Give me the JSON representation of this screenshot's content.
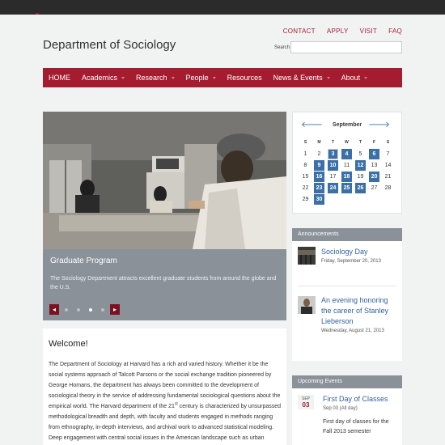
{
  "utility_nav": [
    "CONTACT",
    "APPLY",
    "VISIT",
    "FAQ"
  ],
  "site_title": "Department of Sociology",
  "search": {
    "label": "Search",
    "value": "",
    "placeholder": ""
  },
  "main_nav": [
    {
      "label": "HOME",
      "dropdown": false
    },
    {
      "label": "Academics",
      "dropdown": true
    },
    {
      "label": "Research",
      "dropdown": true
    },
    {
      "label": "People",
      "dropdown": true
    },
    {
      "label": "Resources",
      "dropdown": false
    },
    {
      "label": "News & Events",
      "dropdown": true
    },
    {
      "label": "About",
      "dropdown": true
    }
  ],
  "slider": {
    "title": "Graduate Program",
    "description": "The Sociology Department attracts excellent graduate students from around the globe and the U.S.",
    "prev": "◂",
    "next": "▸",
    "slide_count": 4,
    "active_slide": 3
  },
  "welcome": {
    "heading": "Welcome!",
    "body_part1": "The Department of Sociology at Harvard has a rich and varied history. Whether it be the social systems approach of Talcott Parsons or the social exchange tradition pioneered by George Homans, the department has always been committed to the development of sociological theory in the service of addressing fundamental sociological questions about the empirical world. The Harvard department of the 21",
    "body_sup": "st",
    "body_part2": " century is characterized by unsurpassed methodological breadth and depth, with faculty and students engaged in methods ranging from ethnography, in-depth interviews, and archival work to advanced statistical modeling. Deep engagement with central social issues in the American landscape such as urban inequality and mass incarceration is"
  },
  "calendar": {
    "month": "September",
    "prev": "🡐",
    "next": "🡒",
    "weekdays": [
      "S",
      "M",
      "T",
      "W",
      "T",
      "F",
      "S"
    ],
    "leading_blanks": 0,
    "days": [
      "1",
      "2",
      "3",
      "4",
      "5",
      "6",
      "7",
      "8",
      "9",
      "10",
      "11",
      "12",
      "13",
      "14",
      "15",
      "16",
      "17",
      "18",
      "19",
      "20",
      "21",
      "22",
      "23",
      "24",
      "25",
      "26",
      "27",
      "28",
      "29",
      "30"
    ],
    "event_days": [
      3,
      4,
      6,
      9,
      10,
      12,
      16,
      18,
      20,
      23,
      24,
      25,
      26,
      30
    ],
    "today": 3
  },
  "announcements": {
    "heading": "Announcements",
    "items": [
      {
        "title": "Sociology Day",
        "date": "Friday, September 20, 2013"
      },
      {
        "title": "An evening honoring the career of Stanley Lieberson",
        "date": "Wednesday, August 21, 2013"
      }
    ]
  },
  "upcoming_events": {
    "heading": "Upcoming Events",
    "items": [
      {
        "month": "SEP",
        "day": "03",
        "title": "First Day of Classes",
        "time": "Sep 03 (All day)",
        "description": "First day of classes for the Fall 2013 semester"
      }
    ]
  },
  "colors": {
    "crimson": "#a51c30",
    "link_blue": "#2f63a0",
    "calendar_event": "#3a6fa8",
    "panel_gray": "#8a9198"
  }
}
